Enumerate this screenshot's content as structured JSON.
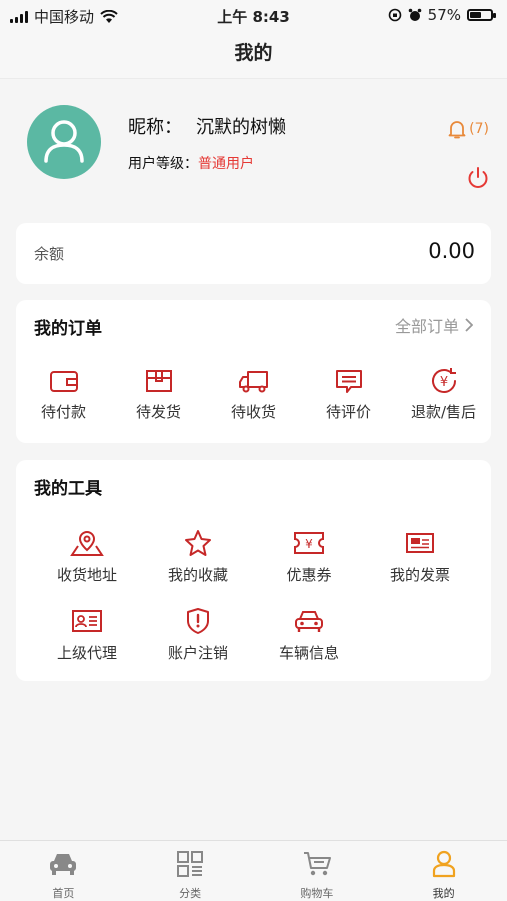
{
  "status_bar": {
    "carrier": "中国移动",
    "time": "上午 8:43",
    "battery": "57%",
    "battery_level": 0.57
  },
  "nav": {
    "title": "我的"
  },
  "profile": {
    "nickname_label": "昵称：",
    "nickname": "沉默的树懒",
    "level_label": "用户等级：",
    "level": "普通用户",
    "notification_count": "(7)"
  },
  "balance": {
    "label": "余额",
    "value": "0.00"
  },
  "orders": {
    "title": "我的订单",
    "all_label": "全部订单",
    "items": [
      {
        "label": "待付款",
        "icon": "wallet-icon"
      },
      {
        "label": "待发货",
        "icon": "box-icon"
      },
      {
        "label": "待收货",
        "icon": "truck-icon"
      },
      {
        "label": "待评价",
        "icon": "comment-icon"
      },
      {
        "label": "退款/售后",
        "icon": "refund-icon"
      }
    ]
  },
  "tools": {
    "title": "我的工具",
    "items": [
      {
        "label": "收货地址",
        "icon": "location-icon"
      },
      {
        "label": "我的收藏",
        "icon": "star-icon"
      },
      {
        "label": "优惠券",
        "icon": "coupon-icon"
      },
      {
        "label": "我的发票",
        "icon": "invoice-icon"
      },
      {
        "label": "上级代理",
        "icon": "id-card-icon"
      },
      {
        "label": "账户注销",
        "icon": "shield-alert-icon"
      },
      {
        "label": "车辆信息",
        "icon": "car-icon"
      }
    ]
  },
  "tab_bar": {
    "items": [
      {
        "label": "首页",
        "icon": "car-home-icon"
      },
      {
        "label": "分类",
        "icon": "grid-icon"
      },
      {
        "label": "购物车",
        "icon": "cart-icon"
      },
      {
        "label": "我的",
        "icon": "user-icon",
        "active": true
      }
    ]
  },
  "colors": {
    "accent": "#e53935",
    "icon_red": "#c62828",
    "avatar_bg": "#5bb8a3",
    "tab_active": "#f0a21f",
    "bell": "#e8893a"
  }
}
